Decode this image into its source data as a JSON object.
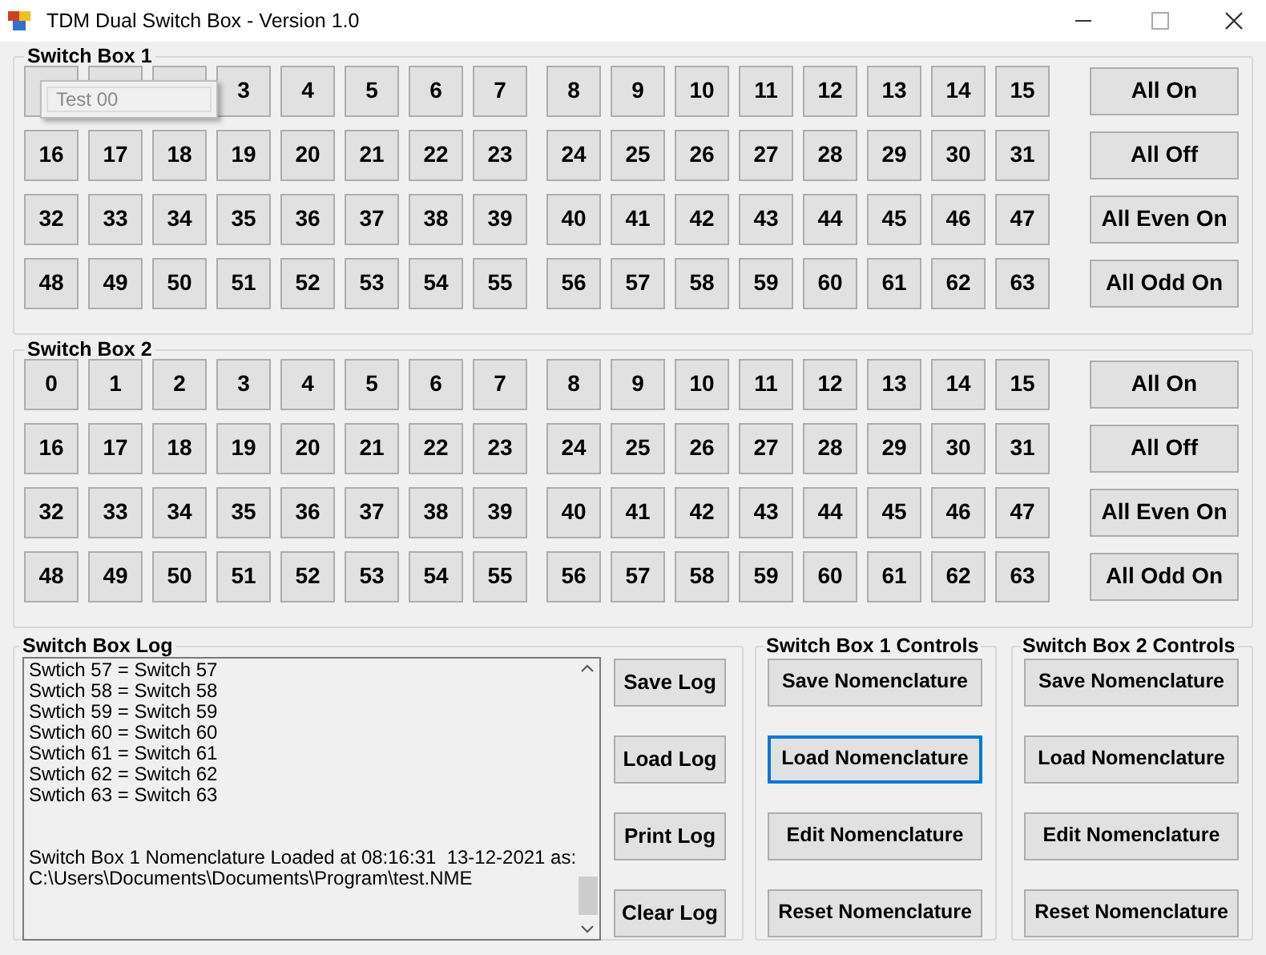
{
  "window": {
    "title": "TDM Dual Switch Box - Version 1.0"
  },
  "boxes": [
    {
      "title": "Switch Box 1",
      "tooltip": {
        "text": "Test 00"
      },
      "rows": [
        {
          "switches": [
            {
              "covered": true
            },
            {
              "covered": true
            },
            {
              "covered": true
            },
            {
              "label": "3"
            },
            {
              "label": "4"
            },
            {
              "label": "5"
            },
            {
              "label": "6"
            },
            {
              "label": "7"
            },
            {
              "label": "8"
            },
            {
              "label": "9"
            },
            {
              "label": "10"
            },
            {
              "label": "11"
            },
            {
              "label": "12"
            },
            {
              "label": "13"
            },
            {
              "label": "14"
            },
            {
              "label": "15"
            }
          ],
          "action": "All On"
        },
        {
          "switches": [
            {
              "label": "16"
            },
            {
              "label": "17"
            },
            {
              "label": "18"
            },
            {
              "label": "19"
            },
            {
              "label": "20"
            },
            {
              "label": "21"
            },
            {
              "label": "22"
            },
            {
              "label": "23"
            },
            {
              "label": "24"
            },
            {
              "label": "25"
            },
            {
              "label": "26"
            },
            {
              "label": "27"
            },
            {
              "label": "28"
            },
            {
              "label": "29"
            },
            {
              "label": "30"
            },
            {
              "label": "31"
            }
          ],
          "action": "All Off"
        },
        {
          "switches": [
            {
              "label": "32"
            },
            {
              "label": "33"
            },
            {
              "label": "34"
            },
            {
              "label": "35"
            },
            {
              "label": "36"
            },
            {
              "label": "37"
            },
            {
              "label": "38"
            },
            {
              "label": "39"
            },
            {
              "label": "40"
            },
            {
              "label": "41"
            },
            {
              "label": "42"
            },
            {
              "label": "43"
            },
            {
              "label": "44"
            },
            {
              "label": "45"
            },
            {
              "label": "46"
            },
            {
              "label": "47"
            }
          ],
          "action": "All Even On"
        },
        {
          "switches": [
            {
              "label": "48"
            },
            {
              "label": "49"
            },
            {
              "label": "50"
            },
            {
              "label": "51"
            },
            {
              "label": "52"
            },
            {
              "label": "53"
            },
            {
              "label": "54"
            },
            {
              "label": "55"
            },
            {
              "label": "56"
            },
            {
              "label": "57"
            },
            {
              "label": "58"
            },
            {
              "label": "59"
            },
            {
              "label": "60"
            },
            {
              "label": "61"
            },
            {
              "label": "62"
            },
            {
              "label": "63"
            }
          ],
          "action": "All Odd On"
        }
      ]
    },
    {
      "title": "Switch Box 2",
      "rows": [
        {
          "switches": [
            {
              "label": "0"
            },
            {
              "label": "1"
            },
            {
              "label": "2"
            },
            {
              "label": "3"
            },
            {
              "label": "4"
            },
            {
              "label": "5"
            },
            {
              "label": "6"
            },
            {
              "label": "7"
            },
            {
              "label": "8"
            },
            {
              "label": "9"
            },
            {
              "label": "10"
            },
            {
              "label": "11"
            },
            {
              "label": "12"
            },
            {
              "label": "13"
            },
            {
              "label": "14"
            },
            {
              "label": "15"
            }
          ],
          "action": "All On"
        },
        {
          "switches": [
            {
              "label": "16"
            },
            {
              "label": "17"
            },
            {
              "label": "18"
            },
            {
              "label": "19"
            },
            {
              "label": "20"
            },
            {
              "label": "21"
            },
            {
              "label": "22"
            },
            {
              "label": "23"
            },
            {
              "label": "24"
            },
            {
              "label": "25"
            },
            {
              "label": "26"
            },
            {
              "label": "27"
            },
            {
              "label": "28"
            },
            {
              "label": "29"
            },
            {
              "label": "30"
            },
            {
              "label": "31"
            }
          ],
          "action": "All Off"
        },
        {
          "switches": [
            {
              "label": "32"
            },
            {
              "label": "33"
            },
            {
              "label": "34"
            },
            {
              "label": "35"
            },
            {
              "label": "36"
            },
            {
              "label": "37"
            },
            {
              "label": "38"
            },
            {
              "label": "39"
            },
            {
              "label": "40"
            },
            {
              "label": "41"
            },
            {
              "label": "42"
            },
            {
              "label": "43"
            },
            {
              "label": "44"
            },
            {
              "label": "45"
            },
            {
              "label": "46"
            },
            {
              "label": "47"
            }
          ],
          "action": "All Even On"
        },
        {
          "switches": [
            {
              "label": "48"
            },
            {
              "label": "49"
            },
            {
              "label": "50"
            },
            {
              "label": "51"
            },
            {
              "label": "52"
            },
            {
              "label": "53"
            },
            {
              "label": "54"
            },
            {
              "label": "55"
            },
            {
              "label": "56"
            },
            {
              "label": "57"
            },
            {
              "label": "58"
            },
            {
              "label": "59"
            },
            {
              "label": "60"
            },
            {
              "label": "61"
            },
            {
              "label": "62"
            },
            {
              "label": "63"
            }
          ],
          "action": "All Odd On"
        }
      ]
    }
  ],
  "log": {
    "title": "Switch Box Log",
    "entries": [
      {
        "lines": [
          "Swtich 57 = Switch 57",
          "Swtich 58 = Switch 58",
          "Swtich 59 = Switch 59",
          "Swtich 60 = Switch 60",
          "Swtich 61 = Switch 61",
          "Swtich 62 = Switch 62",
          "Swtich 63 = Switch 63"
        ]
      },
      {
        "lines": [
          "Switch Box 1 Nomenclature Loaded at 08:16:31  13-12-2021 as:",
          "C:\\Users\\Documents\\Documents\\Program\\test.NME"
        ]
      }
    ],
    "buttons": [
      "Save Log",
      "Load Log",
      "Print Log",
      "Clear Log"
    ]
  },
  "controls": [
    {
      "title": "Switch Box 1 Controls",
      "buttons": [
        {
          "label": "Save Nomenclature",
          "focused": false
        },
        {
          "label": "Load Nomenclature",
          "focused": true
        },
        {
          "label": "Edit Nomenclature",
          "focused": false
        },
        {
          "label": "Reset Nomenclature",
          "focused": false
        }
      ]
    },
    {
      "title": "Switch Box 2 Controls",
      "buttons": [
        {
          "label": "Save Nomenclature",
          "focused": false
        },
        {
          "label": "Load Nomenclature",
          "focused": false
        },
        {
          "label": "Edit Nomenclature",
          "focused": false
        },
        {
          "label": "Reset Nomenclature",
          "focused": false
        }
      ]
    }
  ]
}
